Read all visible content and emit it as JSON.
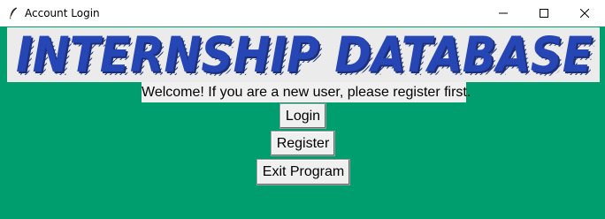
{
  "window": {
    "title": "Account Login",
    "icon": "feather-icon",
    "controls": [
      "minimize-icon",
      "maximize-icon",
      "close-icon"
    ]
  },
  "banner": {
    "text": "INTERNSHIP DATABASE",
    "text_color": "#2546b4",
    "shadow_color": "#1b2f7a",
    "background": "#ebebeb"
  },
  "main": {
    "background": "#009e6f",
    "welcome_text": "Welcome! If you are a new user, please register first.",
    "buttons": {
      "login": "Login",
      "register": "Register",
      "exit": "Exit Program"
    }
  }
}
